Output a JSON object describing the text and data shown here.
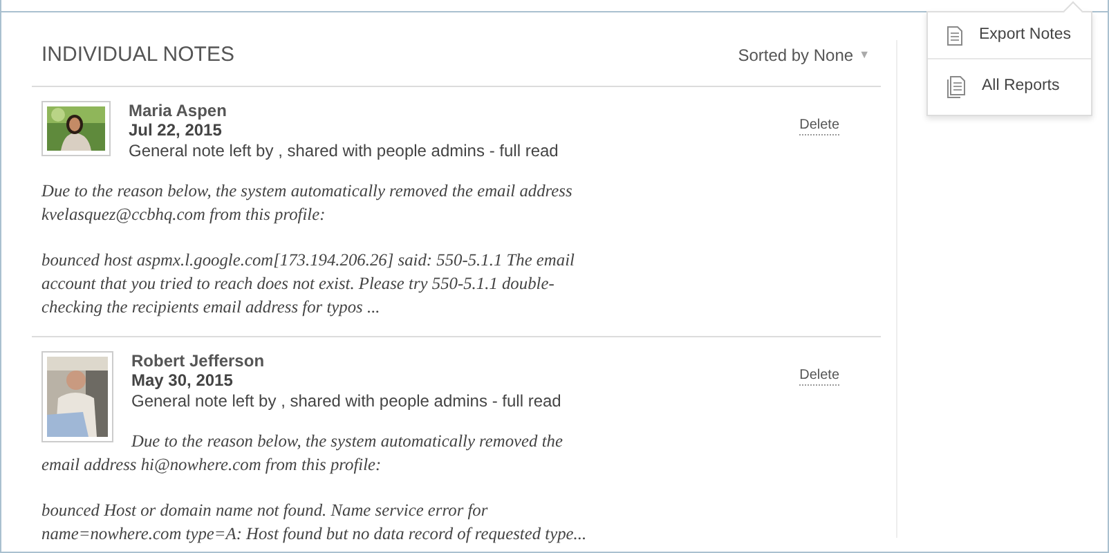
{
  "header": {
    "title": "INDIVIDUAL NOTES",
    "sort": "Sorted by None",
    "sort_caret": "▼"
  },
  "menu": [
    {
      "label": "Export Notes",
      "kind": "single"
    },
    {
      "label": "All Reports",
      "kind": "stack"
    }
  ],
  "notes": [
    {
      "author": "Maria Aspen",
      "date": "Jul 22, 2015",
      "meta": "General note left by , shared with people admins - full read",
      "delete": "Delete",
      "avatar": {
        "kind": "wide"
      },
      "paragraphs": [
        "Due to the reason below, the system automatically removed the email address kvelasquez@ccbhq.com from this profile:",
        "bounced host aspmx.l.google.com[173.194.206.26] said: 550-5.1.1 The email account that you tried to reach does not exist. Please try 550-5.1.1 double-checking the recipients email address for typos ..."
      ]
    },
    {
      "author": "Robert Jefferson",
      "date": "May 30, 2015",
      "meta": "General note left by , shared with people admins - full read",
      "delete": "Delete",
      "avatar": {
        "kind": "tall"
      },
      "paragraphs": [
        "Due to the reason below, the system automatically removed the email address hi@nowhere.com from this profile:",
        "bounced Host or domain name not found. Name service error for name=nowhere.com type=A: Host found but no data record of requested type..."
      ]
    }
  ]
}
